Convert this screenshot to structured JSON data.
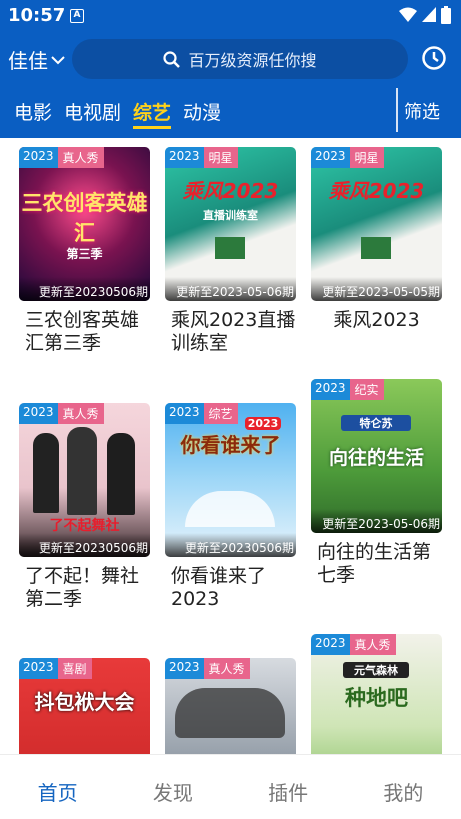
{
  "status": {
    "time": "10:57",
    "a_label": "A"
  },
  "header": {
    "city": "佳佳",
    "search_placeholder": "百万级资源任你搜",
    "tabs": [
      "电影",
      "电视剧",
      "综艺",
      "动漫"
    ],
    "active_tab": "综艺",
    "filter_label": "筛选"
  },
  "cards": [
    {
      "year": "2023",
      "category": "真人秀",
      "update": "更新至20230506期",
      "title": "三农创客英雄汇第三季",
      "poster_text": "三农创客英雄汇",
      "poster_sub": "第三季"
    },
    {
      "year": "2023",
      "category": "明星",
      "update": "更新至2023-05-06期",
      "title": "乘风2023直播训练室",
      "poster_text": "乘风2023",
      "poster_sub": "直播训练室"
    },
    {
      "year": "2023",
      "category": "明星",
      "update": "更新至2023-05-05期",
      "title": "乘风2023",
      "poster_text": "乘风2023",
      "poster_sub": ""
    },
    {
      "year": "2023",
      "category": "真人秀",
      "update": "更新至20230506期",
      "title": "了不起！舞社第二季",
      "poster_text": "了不起舞社",
      "poster_sub": ""
    },
    {
      "year": "2023",
      "category": "综艺",
      "update": "更新至20230506期",
      "title": "你看谁来了2023",
      "poster_text": "你看谁来了",
      "poster_sub": "2023"
    },
    {
      "year": "2023",
      "category": "纪实",
      "update": "更新至2023-05-06期",
      "title": "向往的生活第七季",
      "poster_text": "向往的生活",
      "poster_sub": "特仑苏"
    },
    {
      "year": "2023",
      "category": "喜剧",
      "update": "",
      "title": "",
      "poster_text": "抖包袱大会",
      "poster_sub": ""
    },
    {
      "year": "2023",
      "category": "真人秀",
      "update": "",
      "title": "",
      "poster_text": "",
      "poster_sub": ""
    },
    {
      "year": "2023",
      "category": "真人秀",
      "update": "",
      "title": "",
      "poster_text": "种地吧",
      "poster_sub": "元气森林"
    }
  ],
  "bottom_nav": [
    "首页",
    "发现",
    "插件",
    "我的"
  ],
  "colors": {
    "header_bg": "#0a5ec2",
    "active_tab": "#ffd21a",
    "nav_active": "#1565c0",
    "year_badge": "#1c8ad8",
    "category_badge": "#e8658c"
  }
}
